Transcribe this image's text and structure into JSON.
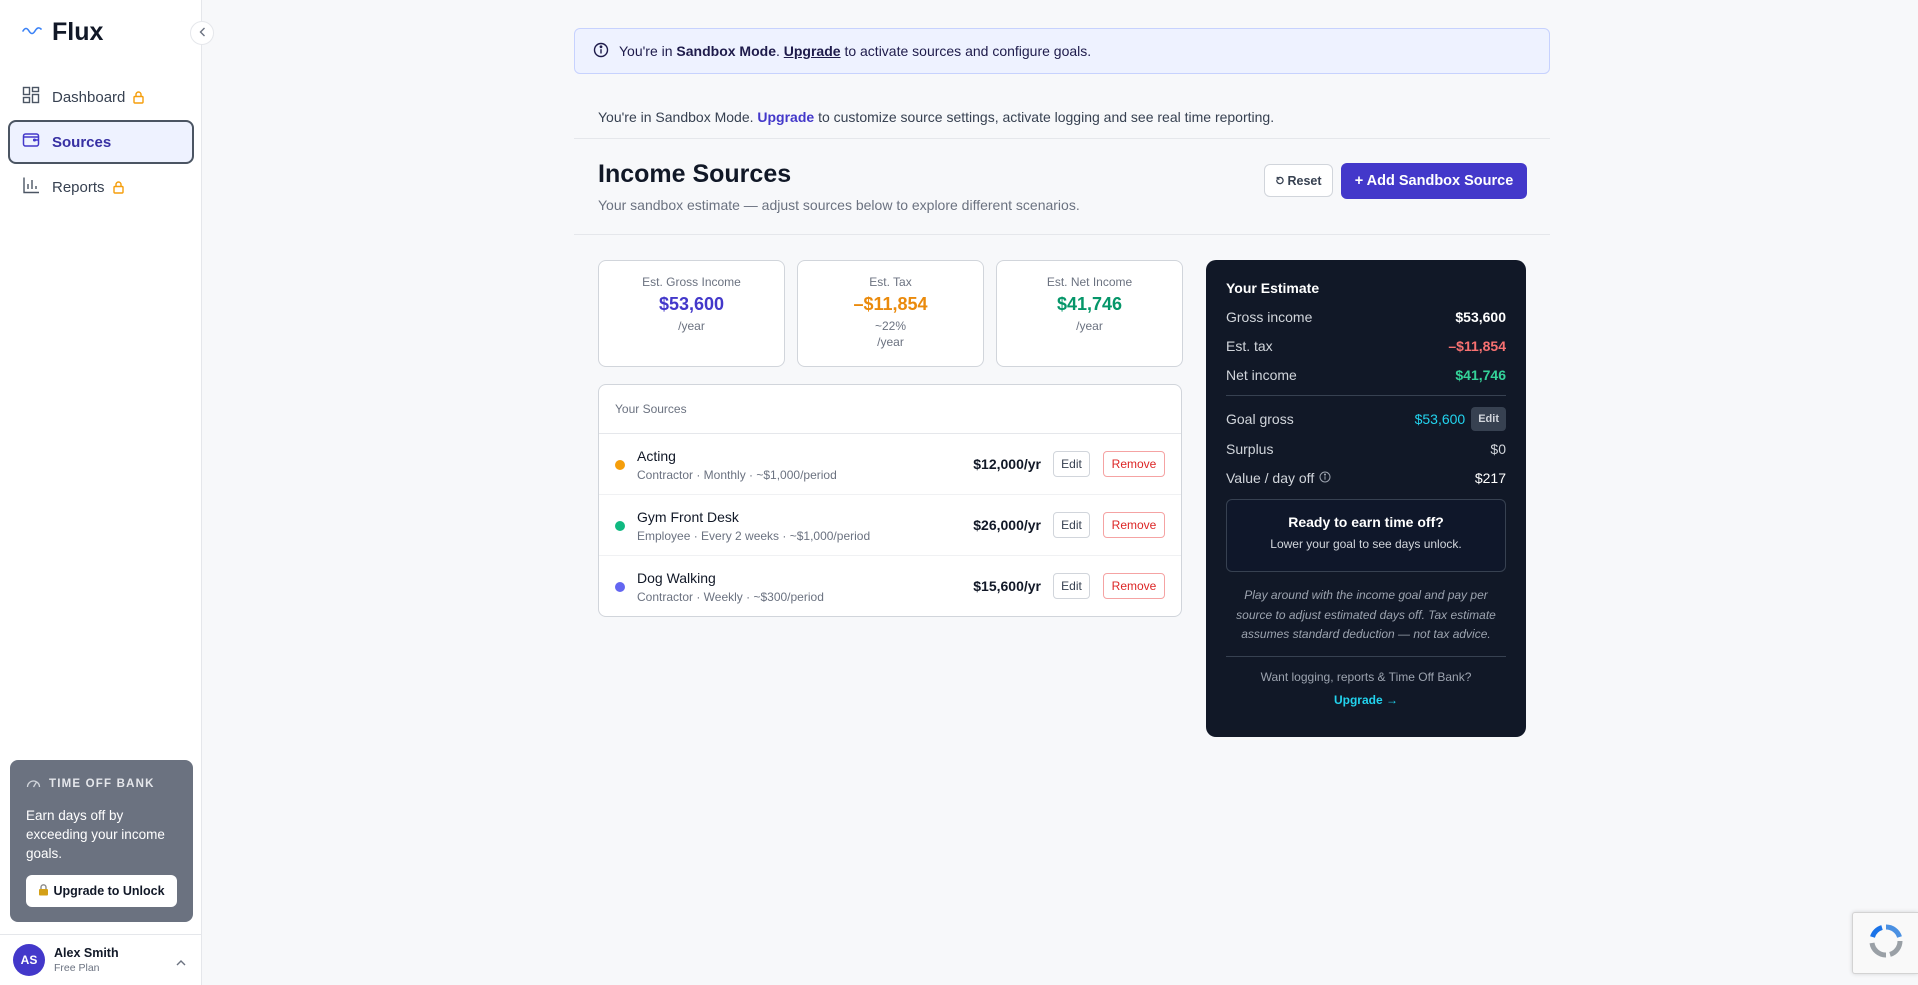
{
  "app": {
    "name": "Flux"
  },
  "sidebar": {
    "items": [
      {
        "label": "Dashboard",
        "locked": true
      },
      {
        "label": "Sources",
        "locked": false,
        "active": true
      },
      {
        "label": "Reports",
        "locked": true
      }
    ],
    "time_off_bank": {
      "title": "TIME OFF BANK",
      "text": "Earn days off by exceeding your income goals.",
      "button": "Upgrade to Unlock"
    },
    "user": {
      "initials": "AS",
      "name": "Alex Smith",
      "plan": "Free Plan"
    }
  },
  "banner": {
    "prefix": "You're in ",
    "mode": "Sandbox Mode",
    "dot": ". ",
    "link": "Upgrade",
    "suffix": " to activate sources and configure goals."
  },
  "notice": {
    "prefix": "You're in Sandbox Mode. ",
    "link": "Upgrade",
    "suffix": " to customize source settings, activate logging and see real time reporting."
  },
  "header": {
    "title": "Income Sources",
    "subtitle": "Your sandbox estimate — adjust sources below to explore different scenarios.",
    "reset_label": "Reset",
    "add_label": "+ Add Sandbox Source"
  },
  "stats": [
    {
      "label": "Est. Gross Income",
      "value": "$53,600",
      "sub": "/year",
      "sub2": "",
      "color": "#4338ca"
    },
    {
      "label": "Est. Tax",
      "value": "–$11,854",
      "sub": "~22%",
      "sub2": "/year",
      "color": "#ea8a0c"
    },
    {
      "label": "Est. Net Income",
      "value": "$41,746",
      "sub": "/year",
      "sub2": "",
      "color": "#059669"
    }
  ],
  "sources": {
    "heading": "Your Sources",
    "edit_label": "Edit",
    "remove_label": "Remove",
    "rows": [
      {
        "name": "Acting",
        "meta": "Contractor · Monthly · ~$1,000/period",
        "amount": "$12,000/yr",
        "color": "#f59e0b"
      },
      {
        "name": "Gym Front Desk",
        "meta": "Employee · Every 2 weeks · ~$1,000/period",
        "amount": "$26,000/yr",
        "color": "#10b981"
      },
      {
        "name": "Dog Walking",
        "meta": "Contractor · Weekly · ~$300/period",
        "amount": "$15,600/yr",
        "color": "#6366f1"
      }
    ]
  },
  "estimate": {
    "title": "Your Estimate",
    "gross_label": "Gross income",
    "gross_value": "$53,600",
    "tax_label": "Est. tax",
    "tax_value": "–$11,854",
    "net_label": "Net income",
    "net_value": "$41,746",
    "goal_label": "Goal gross",
    "goal_value": "$53,600",
    "goal_edit": "Edit",
    "surplus_label": "Surplus",
    "surplus_value": "$0",
    "value_label": "Value / day off",
    "value_value": "$217",
    "ready_title": "Ready to earn time off?",
    "ready_sub": "Lower your goal to see days unlock.",
    "note": "Play around with the income goal and pay per source to adjust estimated days off. Tax estimate assumes standard deduction — not tax advice.",
    "want": "Want logging, reports & Time Off Bank?",
    "upgrade": "Upgrade →"
  }
}
